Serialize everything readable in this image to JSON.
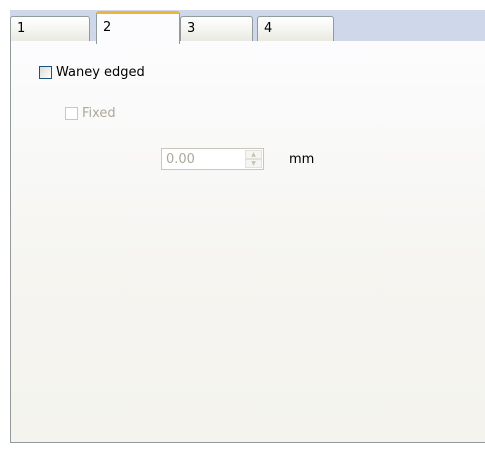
{
  "tabs": [
    {
      "label": "1",
      "active": false
    },
    {
      "label": "2",
      "active": true
    },
    {
      "label": "3",
      "active": false
    },
    {
      "label": "4",
      "active": false
    }
  ],
  "options": {
    "waney_edged": {
      "label": "Waney edged",
      "checked": false,
      "enabled": true
    },
    "fixed": {
      "label": "Fixed",
      "checked": false,
      "enabled": false
    }
  },
  "spinner": {
    "value": "0.00",
    "unit": "mm",
    "enabled": false
  },
  "icons": {
    "spin_up": "spin-up-arrow-icon",
    "spin_down": "spin-down-arrow-icon"
  },
  "colors": {
    "active_tab_accent": "#f0b43a",
    "tab_strip": "#cfd8ea",
    "border": "#919b9c",
    "checkbox_border": "#1c5180",
    "disabled_text": "#aca899"
  }
}
